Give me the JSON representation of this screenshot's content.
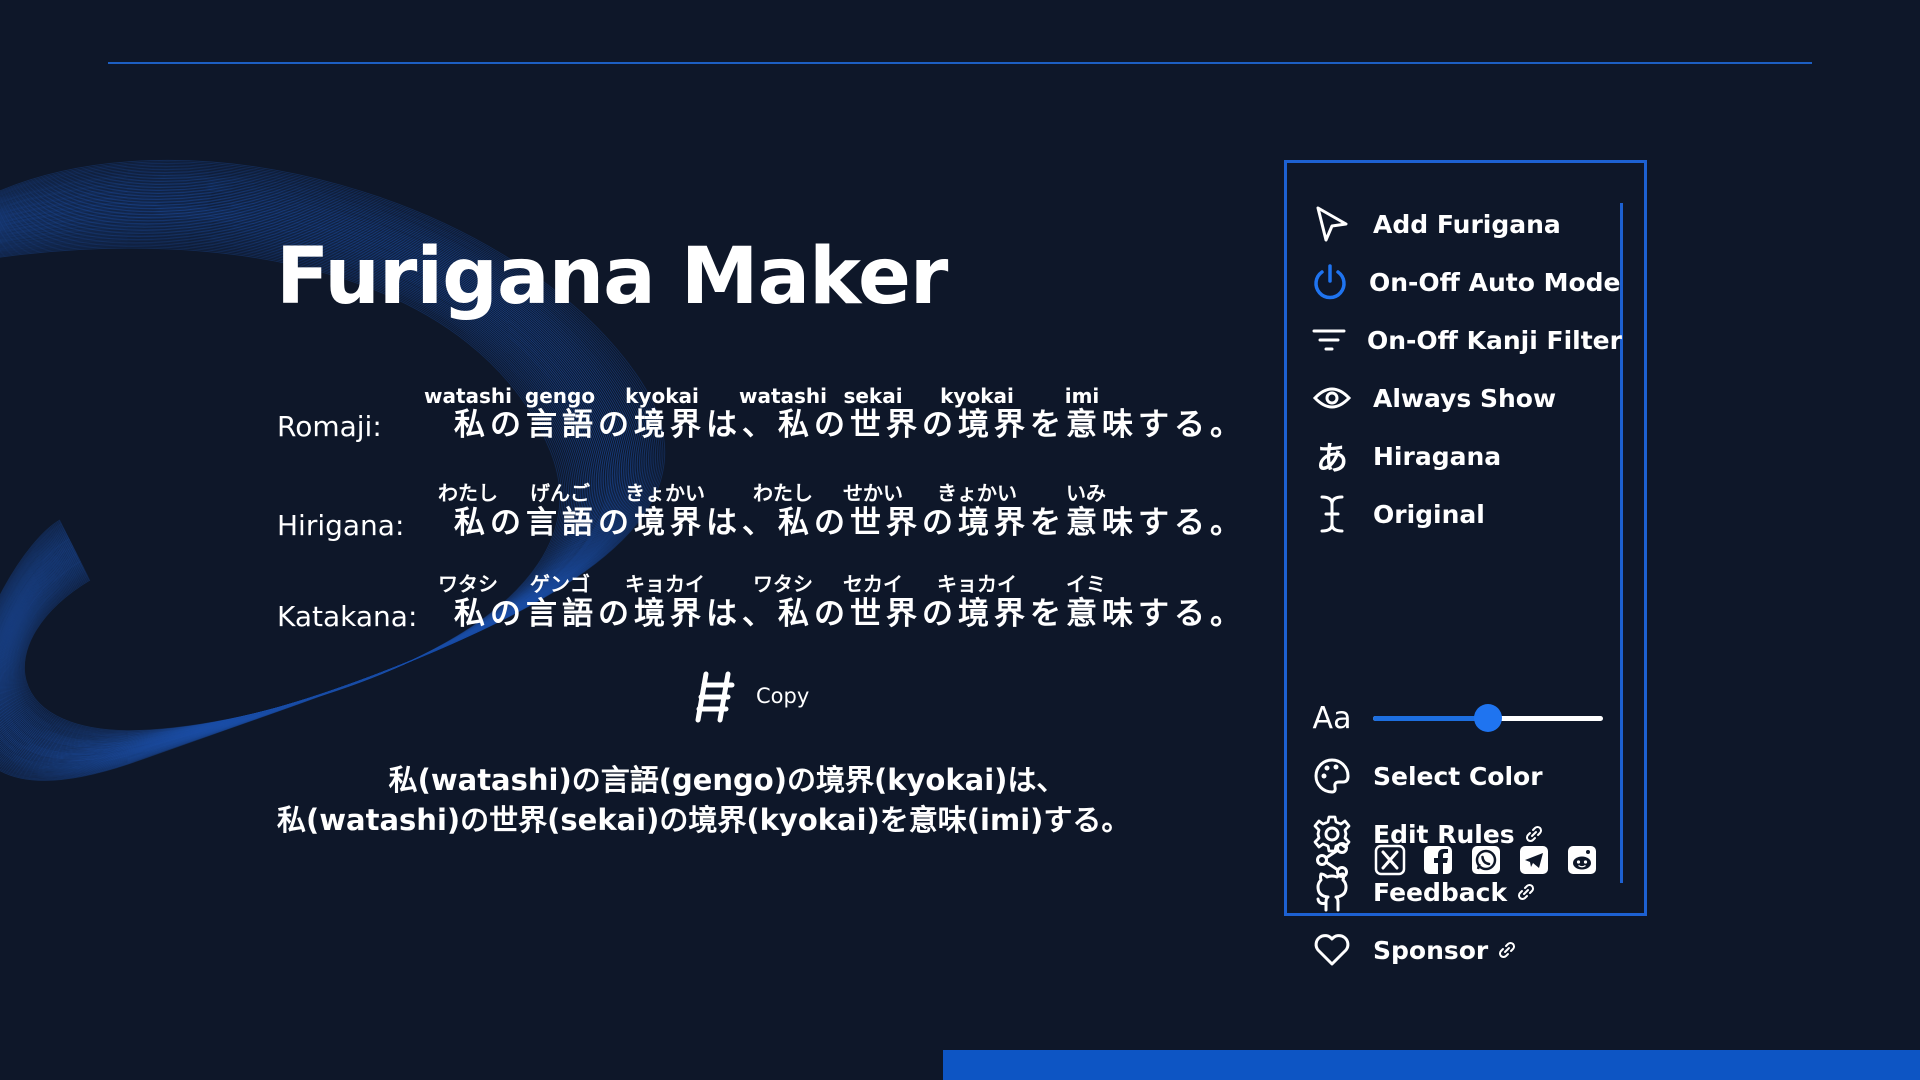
{
  "app": {
    "title": "Furigana Maker"
  },
  "rows": [
    {
      "label": "Romaji:",
      "sentence": "私の言語の境界は、私の世界の境界を意味する。",
      "annotations": [
        "watashi",
        "gengo",
        "kyokai",
        "watashi",
        "sekai",
        "kyokai",
        "imi"
      ]
    },
    {
      "label": "Hirigana:",
      "sentence": "私の言語の境界は、私の世界の境界を意味する。",
      "annotations": [
        "わたし",
        "げんご",
        "きょかい",
        "わたし",
        "せかい",
        "きょかい",
        "いみ"
      ]
    },
    {
      "label": "Katakana:",
      "sentence": "私の言語の境界は、私の世界の境界を意味する。",
      "annotations": [
        "ワタシ",
        "ゲンゴ",
        "キョカイ",
        "ワタシ",
        "セカイ",
        "キョカイ",
        "イミ"
      ]
    }
  ],
  "copy": {
    "label": "Copy",
    "icon": "ladder-icon"
  },
  "result": {
    "line1": "私(watashi)の言語(gengo)の境界(kyokai)は、",
    "line2": "私(watashi)の世界(sekai)の境界(kyokai)を意味(imi)する。"
  },
  "menu": {
    "add_furigana": "Add Furigana",
    "auto_mode": "On-Off Auto Mode",
    "kanji_filter": "On-Off Kanji Filter",
    "always_show": "Always Show",
    "hiragana": "Hiragana",
    "original": "Original",
    "font_size_icon_text": "Aa",
    "font_size_level": 0.5,
    "select_color": "Select Color",
    "edit_rules": "Edit Rules",
    "feedback": "Feedback",
    "sponsor": "Sponsor",
    "hiragana_icon_text": "あ"
  },
  "share": {
    "icon": "share-icon",
    "targets": [
      "x-icon",
      "facebook-icon",
      "whatsapp-icon",
      "telegram-icon",
      "reddit-icon"
    ]
  },
  "colors": {
    "background": "#0e1729",
    "accent": "#1d61d2",
    "power_icon": "#1f74f0"
  }
}
